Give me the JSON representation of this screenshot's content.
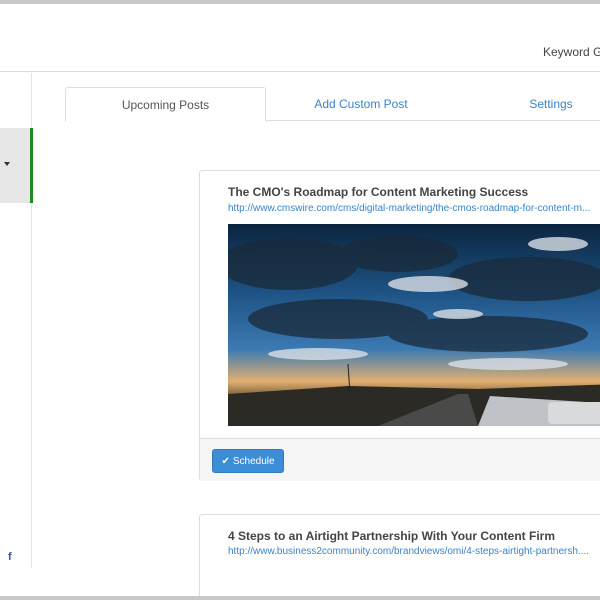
{
  "header": {
    "right_text": "Keyword G"
  },
  "sidebar": {
    "active_item_icon": "caret-down-icon",
    "footer_icon": "facebook-icon",
    "footer_icon_glyph": "f",
    "accent_color": "#1f8a1f"
  },
  "tabs": [
    {
      "label": "Upcoming Posts",
      "active": true
    },
    {
      "label": "Add Custom Post",
      "active": false
    },
    {
      "label": "Settings",
      "active": false
    }
  ],
  "posts": [
    {
      "title": "The CMO's Roadmap for Content Marketing Success",
      "url": "http://www.cmswire.com/cms/digital-marketing/the-cmos-roadmap-for-content-m...",
      "image_icon": "landscape-sunset-photo",
      "button_label": "Schedule",
      "button_icon": "check-icon"
    },
    {
      "title": "4 Steps to an Airtight Partnership With Your Content Firm",
      "url": "http://www.business2community.com/brandviews/omi/4-steps-airtight-partnersh...."
    }
  ],
  "colors": {
    "link": "#3a83c8",
    "button": "#3c8dd6"
  }
}
